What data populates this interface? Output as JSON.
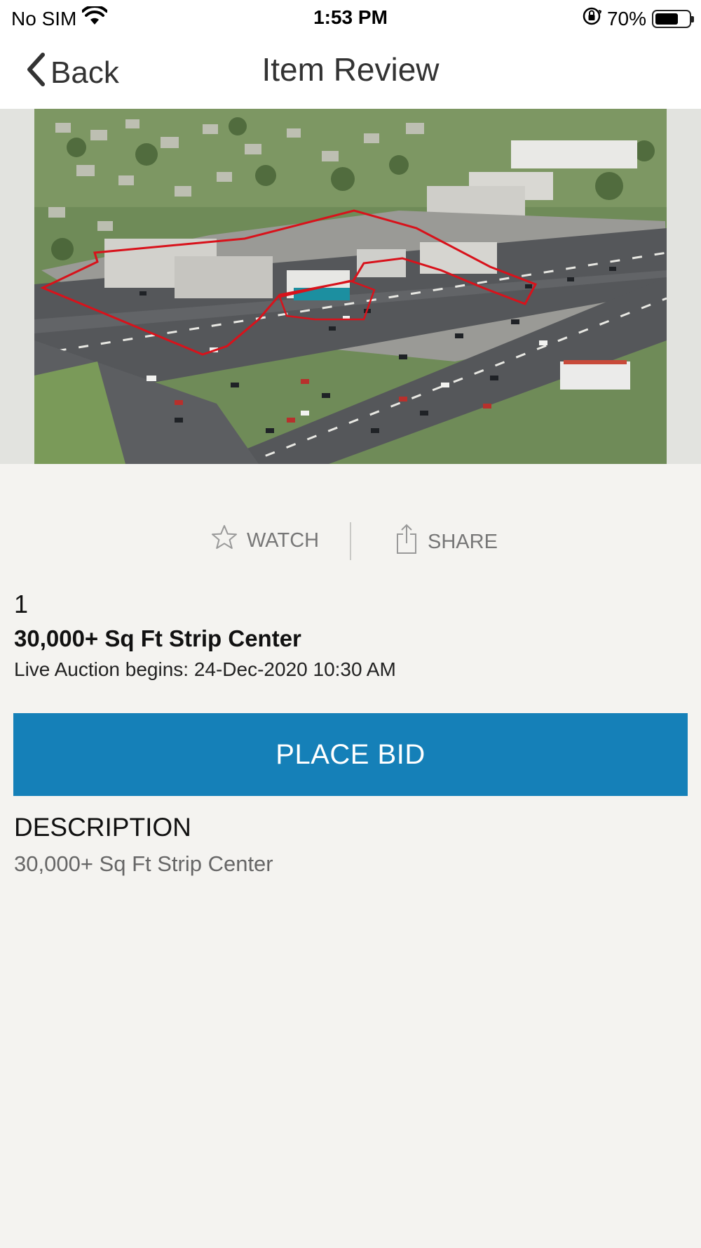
{
  "status_bar": {
    "carrier": "No SIM",
    "time": "1:53 PM",
    "battery_percent": "70%",
    "battery_level": 0.7,
    "icons": [
      "wifi-icon",
      "orientation-lock-icon",
      "battery-icon"
    ]
  },
  "nav": {
    "back_label": "Back",
    "title": "Item Review"
  },
  "actions": {
    "watch_label": "WATCH",
    "share_label": "SHARE"
  },
  "item": {
    "lot_number": "1",
    "title": "30,000+ Sq Ft Strip Center",
    "auction_info": "Live Auction begins: 24-Dec-2020 10:30 AM"
  },
  "bid_button_label": "PLACE BID",
  "description": {
    "heading": "DESCRIPTION",
    "text": "30,000+ Sq Ft Strip Center"
  },
  "colors": {
    "primary": "#1580b8",
    "background": "#f4f3f0",
    "highlight_outline": "#d8121b"
  }
}
